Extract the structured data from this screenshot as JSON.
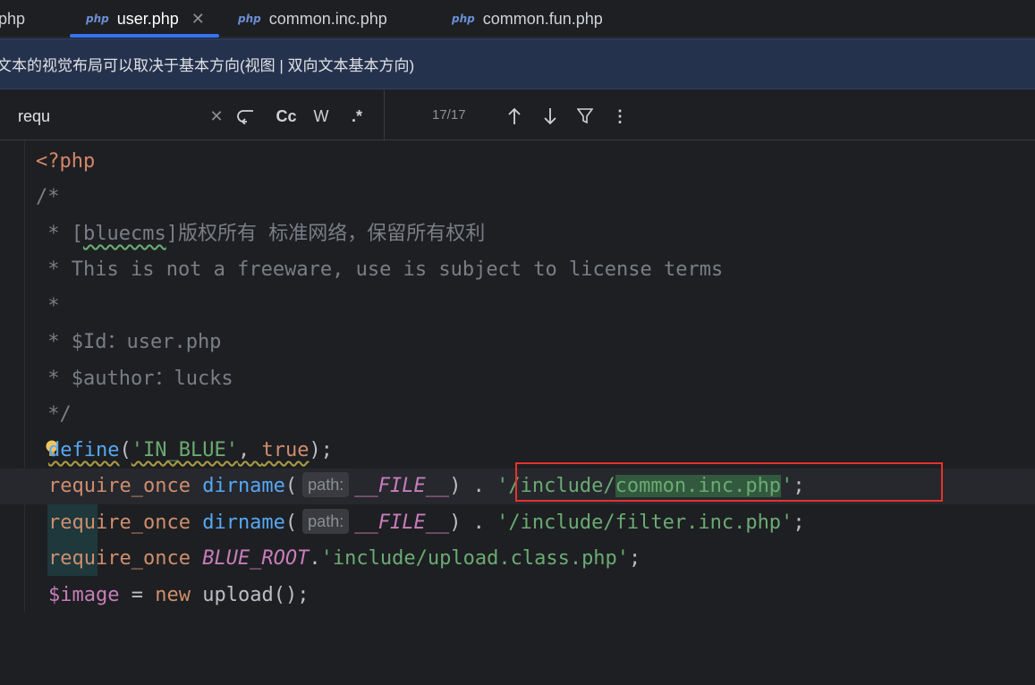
{
  "tabs": [
    {
      "label": "php"
    },
    {
      "icon": "php",
      "label": "user.php",
      "active": true
    },
    {
      "icon": "php",
      "label": "common.inc.php"
    },
    {
      "icon": "php",
      "label": "common.fun.php"
    }
  ],
  "banner": {
    "text": "文本的视觉布局可以取决于基本方向(视图 | 双向文本基本方向)"
  },
  "search": {
    "query": "requ",
    "match_count": "17/17",
    "options": {
      "case": "Cc",
      "word": "W",
      "regex": ".*"
    }
  },
  "code": {
    "l1": "<?php",
    "l2": "/*",
    "l3a": " * [",
    "l3b": "bluecms",
    "l3c": "]版权所有 标准网络，保留所有权利",
    "l4": " * This is not a freeware, use is subject to license terms",
    "l5": " *",
    "l6": " * $Id：user.php",
    "l7": " * $author：lucks",
    "l8": " */",
    "l9_fn": "define",
    "l9_arg1": "'IN_BLUE'",
    "l9_arg2": "true",
    "require": "require_once",
    "dirname": "dirname",
    "hint_path": "path:",
    "file_const": "__FILE__",
    "l10_str_a": "'/include/",
    "l10_str_b": "common.inc.php",
    "l10_str_c": "'",
    "l11_str": "'/include/filter.inc.php'",
    "blue_root": "BLUE_ROOT",
    "l12_str": "'include/upload.class.php'",
    "l13_var": "$image",
    "l13_new": "new",
    "l13_cls": "upload"
  },
  "colors": {
    "accent": "#3574f0",
    "highlight_box": "#e5322d"
  }
}
